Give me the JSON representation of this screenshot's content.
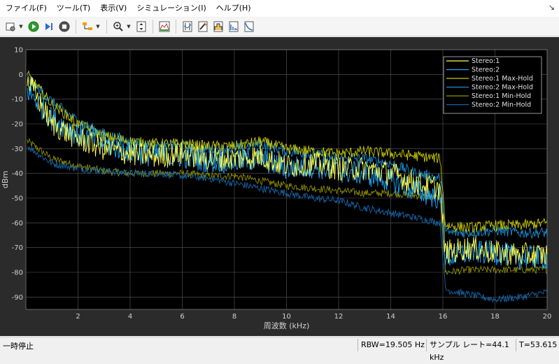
{
  "menubar": {
    "items": [
      "ファイル(F)",
      "ツール(T)",
      "表示(V)",
      "シミュレーション(I)",
      "ヘルプ(H)"
    ]
  },
  "toolbar": {
    "icons": [
      "settings-icon",
      "play-icon",
      "step-forward-icon",
      "stop-icon",
      "triggers-icon",
      "zoom-in-icon",
      "scale-axes-icon",
      "spectrum-icon",
      "data-cursor-icon",
      "peak-finder-icon",
      "channel-measurements-icon",
      "distortion-icon",
      "ccdf-icon"
    ]
  },
  "colors": {
    "stereo1": "#ffff54",
    "stereo2": "#1ca8ff",
    "stereo1_max": "#c8c800",
    "stereo2_max": "#1a8fd0",
    "stereo1_min": "#8f8f00",
    "stereo2_min": "#1466a8",
    "axes_bg": "#000000",
    "grid": "#5a5a5a",
    "tick_text": "#d0d0d0"
  },
  "chart_data": {
    "type": "line",
    "xlabel": "周波数 (kHz)",
    "ylabel": "dBm",
    "xlim": [
      0,
      20
    ],
    "ylim": [
      -95,
      10
    ],
    "xticks": [
      2,
      4,
      6,
      8,
      10,
      12,
      14,
      16,
      18,
      20
    ],
    "yticks": [
      10,
      0,
      -10,
      -20,
      -30,
      -40,
      -50,
      -60,
      -70,
      -80,
      -90
    ],
    "grid": true,
    "legend_position": "top-right",
    "series": [
      {
        "name": "Stereo:1",
        "x": [
          0.2,
          1,
          2,
          3,
          4,
          5,
          6,
          7,
          8,
          9,
          10,
          11,
          12,
          13,
          14,
          15,
          15.9,
          16.1,
          17,
          18,
          19,
          20
        ],
        "y": [
          -5,
          -20,
          -26,
          -30,
          -32,
          -33,
          -32,
          -34,
          -34,
          -33,
          -37,
          -36,
          -38,
          -38,
          -40,
          -44,
          -46,
          -72,
          -70,
          -72,
          -73,
          -73
        ]
      },
      {
        "name": "Stereo:2",
        "x": [
          0.2,
          1,
          2,
          3,
          4,
          5,
          6,
          7,
          8,
          9,
          10,
          11,
          12,
          13,
          14,
          15,
          15.9,
          16.1,
          17,
          18,
          19,
          20
        ],
        "y": [
          -8,
          -18,
          -24,
          -28,
          -31,
          -33,
          -33,
          -35,
          -35,
          -34,
          -38,
          -37,
          -39,
          -40,
          -43,
          -47,
          -50,
          -74,
          -72,
          -72,
          -74,
          -74
        ]
      },
      {
        "name": "Stereo:1 Max-Hold",
        "x": [
          0.2,
          1,
          2,
          3,
          4,
          5,
          6,
          7,
          8,
          9,
          10,
          11,
          12,
          13,
          14,
          15,
          15.9,
          16.1,
          17,
          18,
          19,
          20
        ],
        "y": [
          -2,
          -12,
          -20,
          -25,
          -27,
          -28,
          -28,
          -29,
          -29,
          -27,
          -30,
          -31,
          -32,
          -31,
          -32,
          -33,
          -34,
          -61,
          -62,
          -61,
          -61,
          -60
        ]
      },
      {
        "name": "Stereo:2 Max-Hold",
        "x": [
          0.2,
          1,
          2,
          3,
          4,
          5,
          6,
          7,
          8,
          9,
          10,
          11,
          12,
          13,
          14,
          15,
          15.9,
          16.1,
          17,
          18,
          19,
          20
        ],
        "y": [
          -3,
          -11,
          -19,
          -24,
          -27,
          -29,
          -29,
          -30,
          -30,
          -28,
          -31,
          -32,
          -34,
          -34,
          -36,
          -40,
          -42,
          -64,
          -64,
          -63,
          -64,
          -64
        ]
      },
      {
        "name": "Stereo:1 Min-Hold",
        "x": [
          0.2,
          1,
          2,
          3,
          4,
          5,
          6,
          7,
          8,
          9,
          10,
          11,
          12,
          13,
          14,
          15,
          15.9,
          16.1,
          17,
          18,
          19,
          20
        ],
        "y": [
          -28,
          -34,
          -37,
          -39,
          -40,
          -40,
          -40,
          -41,
          -41,
          -43,
          -45,
          -46,
          -47,
          -48,
          -48,
          -49,
          -50,
          -80,
          -79,
          -79,
          -79,
          -79
        ]
      },
      {
        "name": "Stereo:2 Min-Hold",
        "x": [
          0.2,
          1,
          2,
          3,
          4,
          5,
          6,
          7,
          8,
          9,
          10,
          11,
          12,
          13,
          14,
          15,
          15.9,
          16.1,
          17,
          18,
          19,
          20
        ],
        "y": [
          -30,
          -36,
          -38,
          -39,
          -40,
          -40,
          -41,
          -42,
          -44,
          -46,
          -48,
          -50,
          -51,
          -54,
          -56,
          -58,
          -60,
          -87,
          -89,
          -91,
          -90,
          -88
        ]
      }
    ]
  },
  "status": {
    "state": "一時停止",
    "rbw": "RBW=19.505 Hz",
    "sample_rate": "サンプル レート=44.1 kHz",
    "time": "T=53.615"
  }
}
